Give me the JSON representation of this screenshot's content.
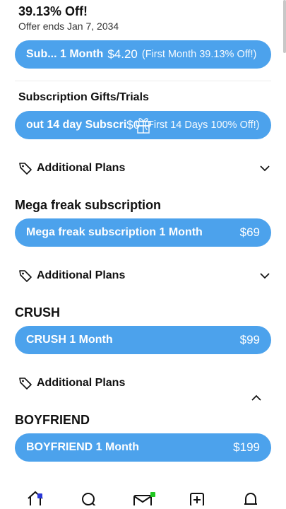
{
  "offer": {
    "title": "39.13% Off!",
    "ends": "Offer ends Jan 7, 2034"
  },
  "main_plan": {
    "label": "Sub... 1 Month",
    "price": "$4.20",
    "note": "(First Month 39.13% Off!)"
  },
  "gifts": {
    "title": "Subscription Gifts/Trials",
    "trial_label": "out 14 day Subscri",
    "trial_price": "$0",
    "trial_note": "(First 14 Days 100% Off!)"
  },
  "additional_plans_label": "Additional Plans",
  "plans": [
    {
      "title": "Mega freak subscription",
      "button_label": "Mega freak subscription 1 Month",
      "price": "$69"
    },
    {
      "title": "CRUSH",
      "button_label": "CRUSH 1 Month",
      "price": "$99"
    },
    {
      "title": "BOYFRIEND",
      "button_label": "BOYFRIEND 1 Month",
      "price": "$199"
    }
  ],
  "icons": {
    "tag": "tag-icon",
    "chevron_down": "chevron-down-icon",
    "chevron_up": "chevron-up-icon",
    "gift": "gift-icon",
    "nav": [
      "home-icon",
      "search-icon",
      "mail-icon",
      "add-post-icon",
      "bell-icon"
    ]
  },
  "colors": {
    "accent": "#4ca2ec",
    "text": "#111111",
    "background": "#ffffff"
  }
}
